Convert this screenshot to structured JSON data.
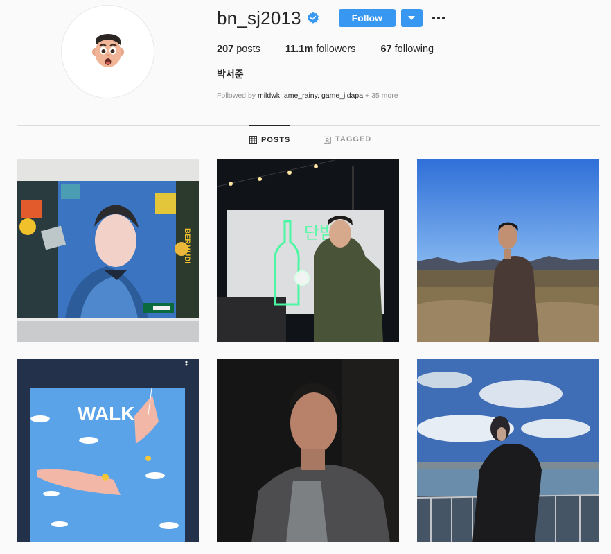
{
  "profile": {
    "username": "bn_sj2013",
    "verified": true,
    "follow_label": "Follow",
    "full_name": "박서준",
    "stats": [
      {
        "value": "207",
        "label": "posts"
      },
      {
        "value": "11.1m",
        "label": "followers"
      },
      {
        "value": "67",
        "label": "following"
      }
    ],
    "followed_by_prefix": "Followed by",
    "followed_by_names": "mildwk, ame_rainy, game_jidapa",
    "followed_by_more": "+ 35 more"
  },
  "tabs": [
    {
      "label": "POSTS",
      "icon": "grid-icon",
      "active": true
    },
    {
      "label": "TAGGED",
      "icon": "tagged-icon",
      "active": false
    }
  ],
  "posts": [
    {
      "description": "mural",
      "sign_text": "BERMUDI"
    },
    {
      "description": "neon-bottle",
      "neon_text": "단밤"
    },
    {
      "description": "sunset-field"
    },
    {
      "description": "walk-poster",
      "poster_text": "WALK"
    },
    {
      "description": "dark-portrait"
    },
    {
      "description": "river-view"
    }
  ],
  "colors": {
    "accent": "#3897f0",
    "verified": "#3897f0",
    "text": "#262626",
    "muted": "#8e8e8e"
  }
}
